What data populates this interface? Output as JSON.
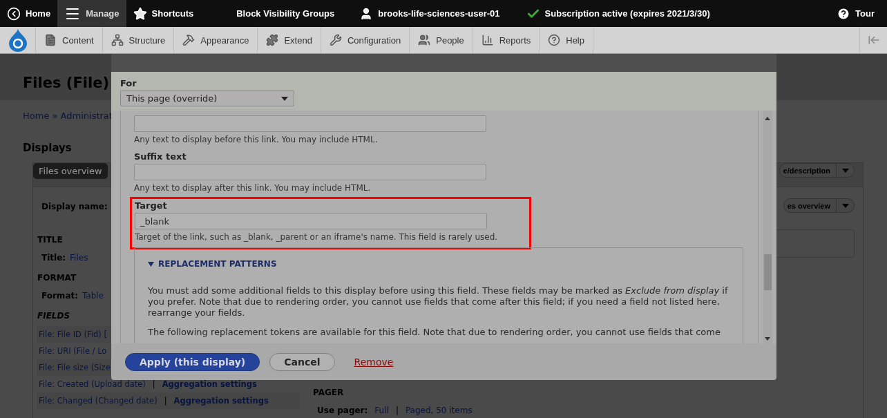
{
  "admin_toolbar": {
    "items": [
      {
        "label": "Home",
        "selected": false
      },
      {
        "label": "Manage",
        "selected": true
      },
      {
        "label": "Shortcuts",
        "selected": false
      },
      {
        "label": "Block Visibility Groups",
        "selected": false
      },
      {
        "label": "brooks-life-sciences-user-01",
        "selected": false
      },
      {
        "label": "Subscription active (expires 2021/3/30)",
        "selected": false
      }
    ],
    "right_item": {
      "label": "Tour"
    }
  },
  "manage_tray": {
    "items": [
      {
        "label": "Content"
      },
      {
        "label": "Structure"
      },
      {
        "label": "Appearance"
      },
      {
        "label": "Extend"
      },
      {
        "label": "Configuration"
      },
      {
        "label": "People"
      },
      {
        "label": "Reports"
      },
      {
        "label": "Help"
      }
    ]
  },
  "page": {
    "title": "Files (File)",
    "breadcrumb": "Home » Administrat",
    "section": "Displays",
    "display_tab": "Files overview",
    "display_name_label": "Display name:",
    "title_heading": "TITLE",
    "title_row": {
      "label": "Title:",
      "value": "Files"
    },
    "format_heading": "FORMAT",
    "format_row": {
      "label": "Format:",
      "value": "Table"
    },
    "fields_heading": "FIELDS",
    "fields": [
      {
        "label": "File: File ID (Fid) ["
      },
      {
        "label": "File: URI (File / Lo"
      },
      {
        "label": "File: File size (Size"
      },
      {
        "label": "File: Created (Upload date)",
        "separator": "|",
        "link": "Aggregation settings"
      },
      {
        "label": "File: Changed (Changed date)",
        "separator": "|",
        "link": "Aggregation settings"
      }
    ],
    "pager_heading": "PAGER",
    "pager_row": {
      "label": "Use pager:",
      "values": [
        "Full",
        "Paged, 50 items"
      ],
      "separator": "|"
    },
    "tab_action": "e/description",
    "display_select": "es overview"
  },
  "dialog": {
    "for_label": "For",
    "for_value": "This page (override)",
    "prefix_field": {
      "help": "Any text to display before this link. You may include HTML."
    },
    "suffix_field": {
      "label": "Suffix text",
      "help": "Any text to display after this link. You may include HTML."
    },
    "target_field": {
      "label": "Target",
      "value": "_blank",
      "help": "Target of the link, such as _blank, _parent or an iframe's name. This field is rarely used.",
      "highlighted": true
    },
    "replacement_patterns": {
      "legend": "REPLACEMENT PATTERNS",
      "expanded": true,
      "paragraphs": [
        "You must add some additional fields to this display before using this field. These fields may be marked as *Exclude from display* if you prefer. Note that due to rendering order, you cannot use fields that come after this field; if you need a field not listed here, rearrange your fields.",
        "The following replacement tokens are available for this field. Note that due to rendering order, you cannot use fields that come"
      ]
    },
    "buttons": [
      {
        "label": "Apply (this display)",
        "kind": "primary"
      },
      {
        "label": "Cancel",
        "kind": "secondary"
      },
      {
        "label": "Remove",
        "kind": "link"
      }
    ]
  }
}
